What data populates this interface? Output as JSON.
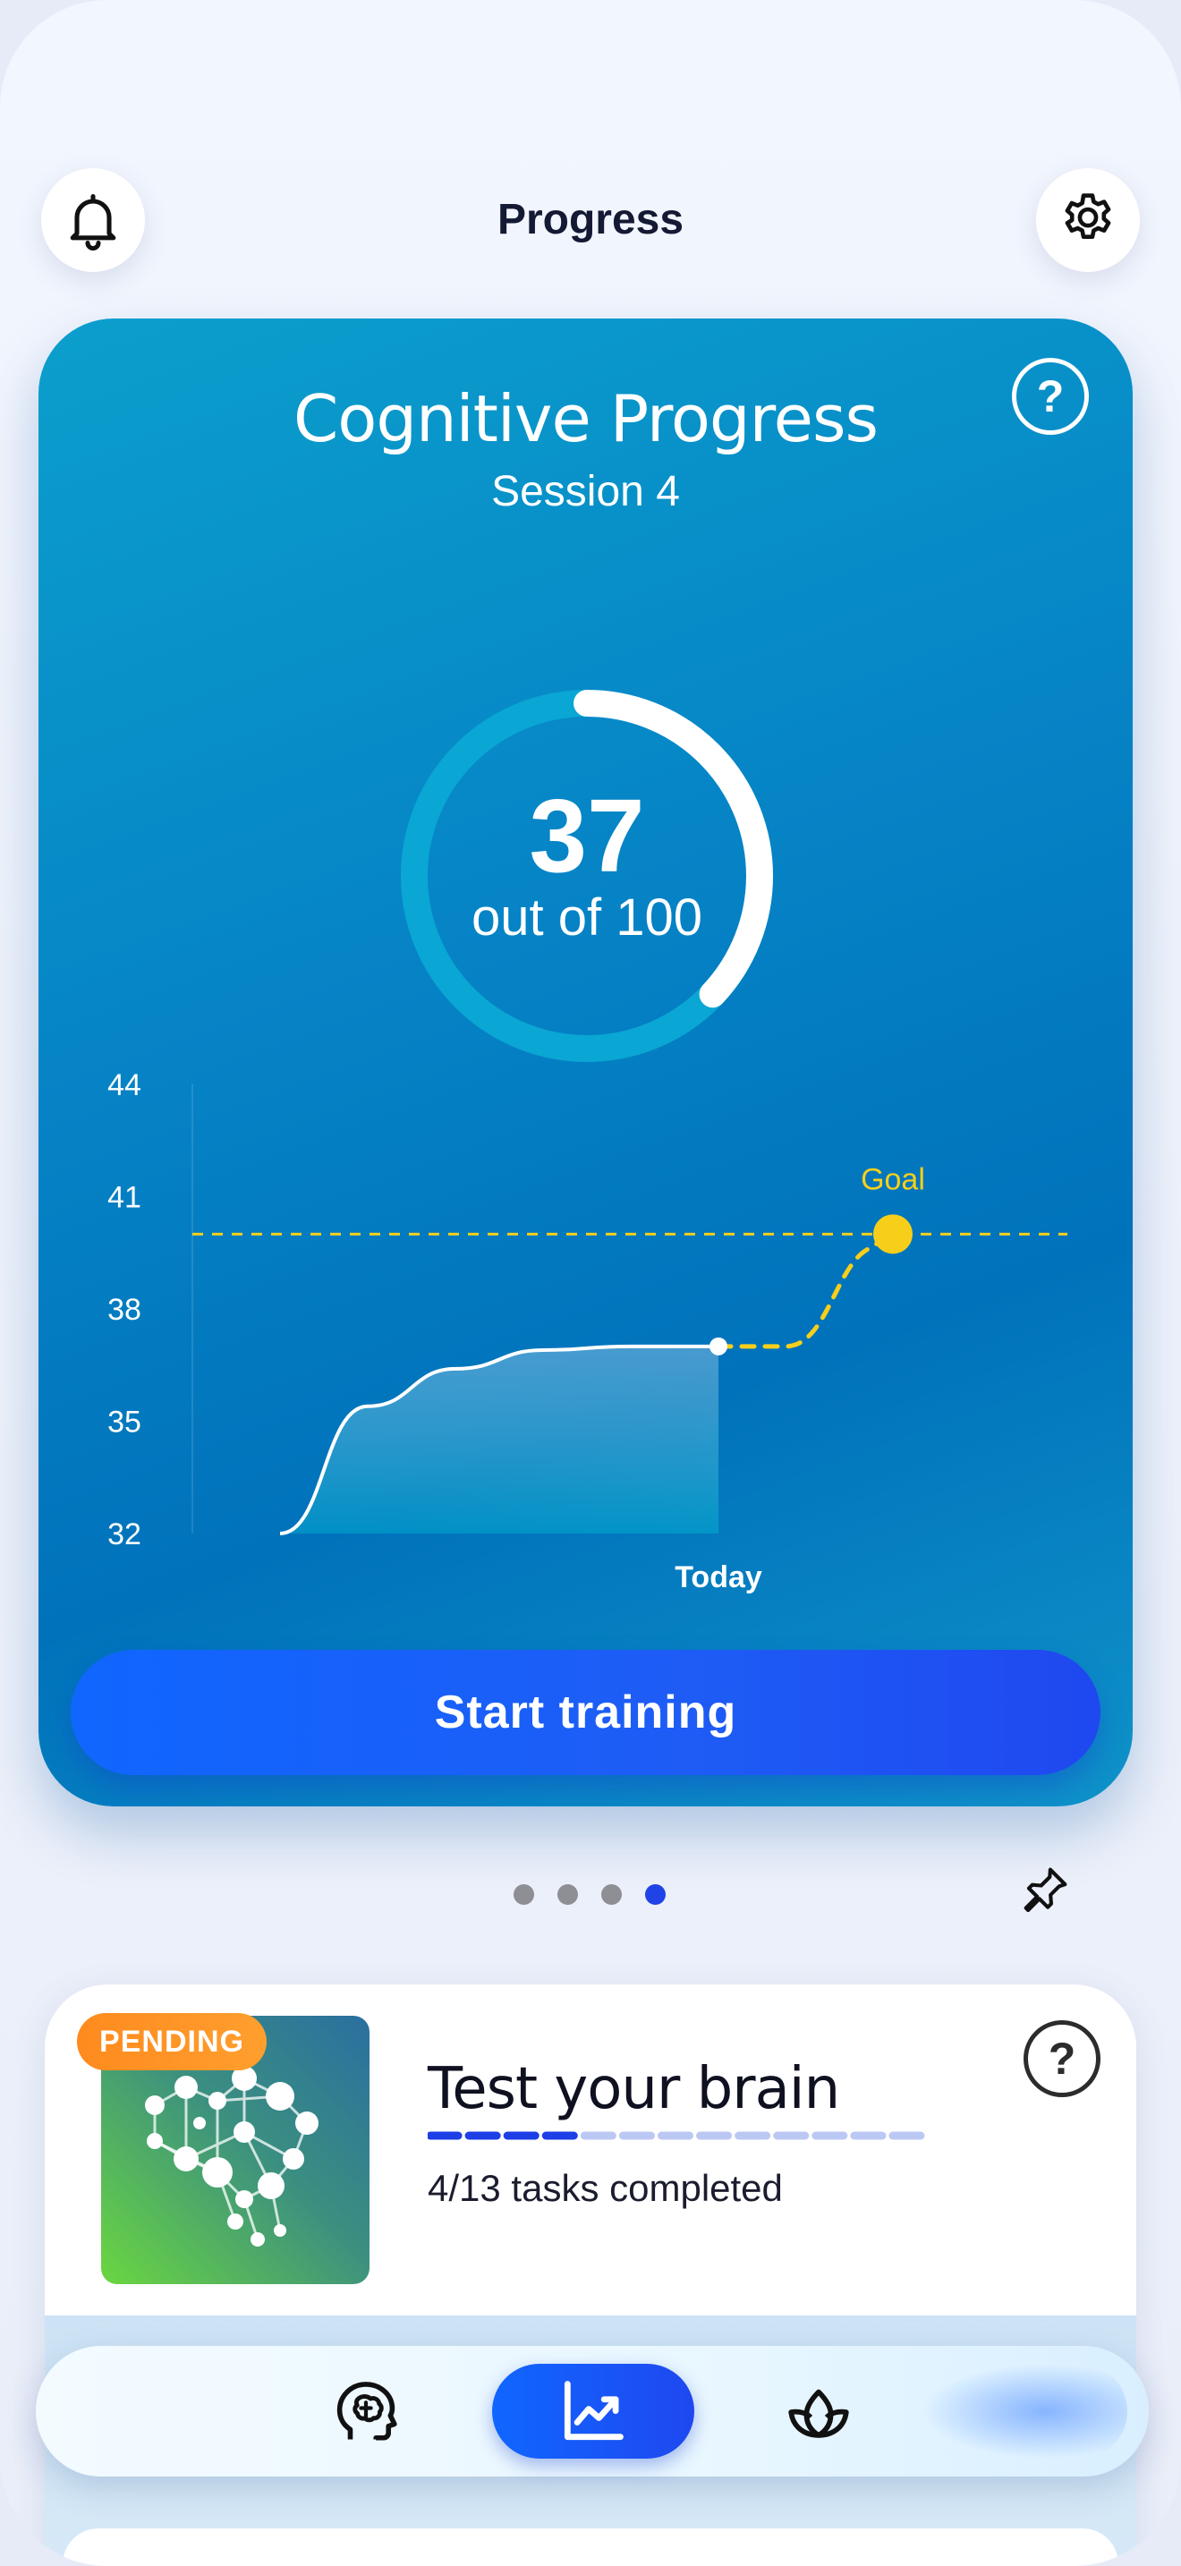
{
  "header": {
    "title": "Progress",
    "left_icon": "bell-icon",
    "right_icon": "gear-icon"
  },
  "hero_card": {
    "title": "Cognitive Progress",
    "subtitle": "Session 4",
    "help_label": "?",
    "score": {
      "value": "37",
      "caption": "out of 100",
      "progress_fraction": 0.37
    },
    "cta_label": "Start training",
    "colors": {
      "card": "#0684c6",
      "goal": "#f7cf1a",
      "cta": "#1e5cf5"
    }
  },
  "chart_data": {
    "type": "line",
    "y_ticks": [
      "44",
      "41",
      "38",
      "35",
      "32"
    ],
    "ylim": [
      32,
      44
    ],
    "series": [
      {
        "x": [
          0.0,
          0.2,
          0.4,
          0.6,
          0.8,
          1.0
        ],
        "values": [
          32,
          35.4,
          36.4,
          36.9,
          37.0,
          37.0
        ]
      }
    ],
    "today_label": "Today",
    "today_value": 37,
    "projection": {
      "from": 37,
      "to": 40
    },
    "goal": {
      "label": "Goal",
      "value": 40
    }
  },
  "carousel": {
    "pages": 4,
    "active_index": 3,
    "pin_icon": "pin-icon"
  },
  "task_card": {
    "badge": "PENDING",
    "title": "Test your brain",
    "subtitle": "4/13 tasks completed",
    "completed": 4,
    "total": 13,
    "help_label": "?",
    "thumbnail_icon": "neural-network-icon"
  },
  "bottom_nav": {
    "items": [
      {
        "icon": "brain-head-icon",
        "active": false
      },
      {
        "icon": "chart-trend-icon",
        "active": true
      },
      {
        "icon": "lotus-icon",
        "active": false
      }
    ]
  }
}
